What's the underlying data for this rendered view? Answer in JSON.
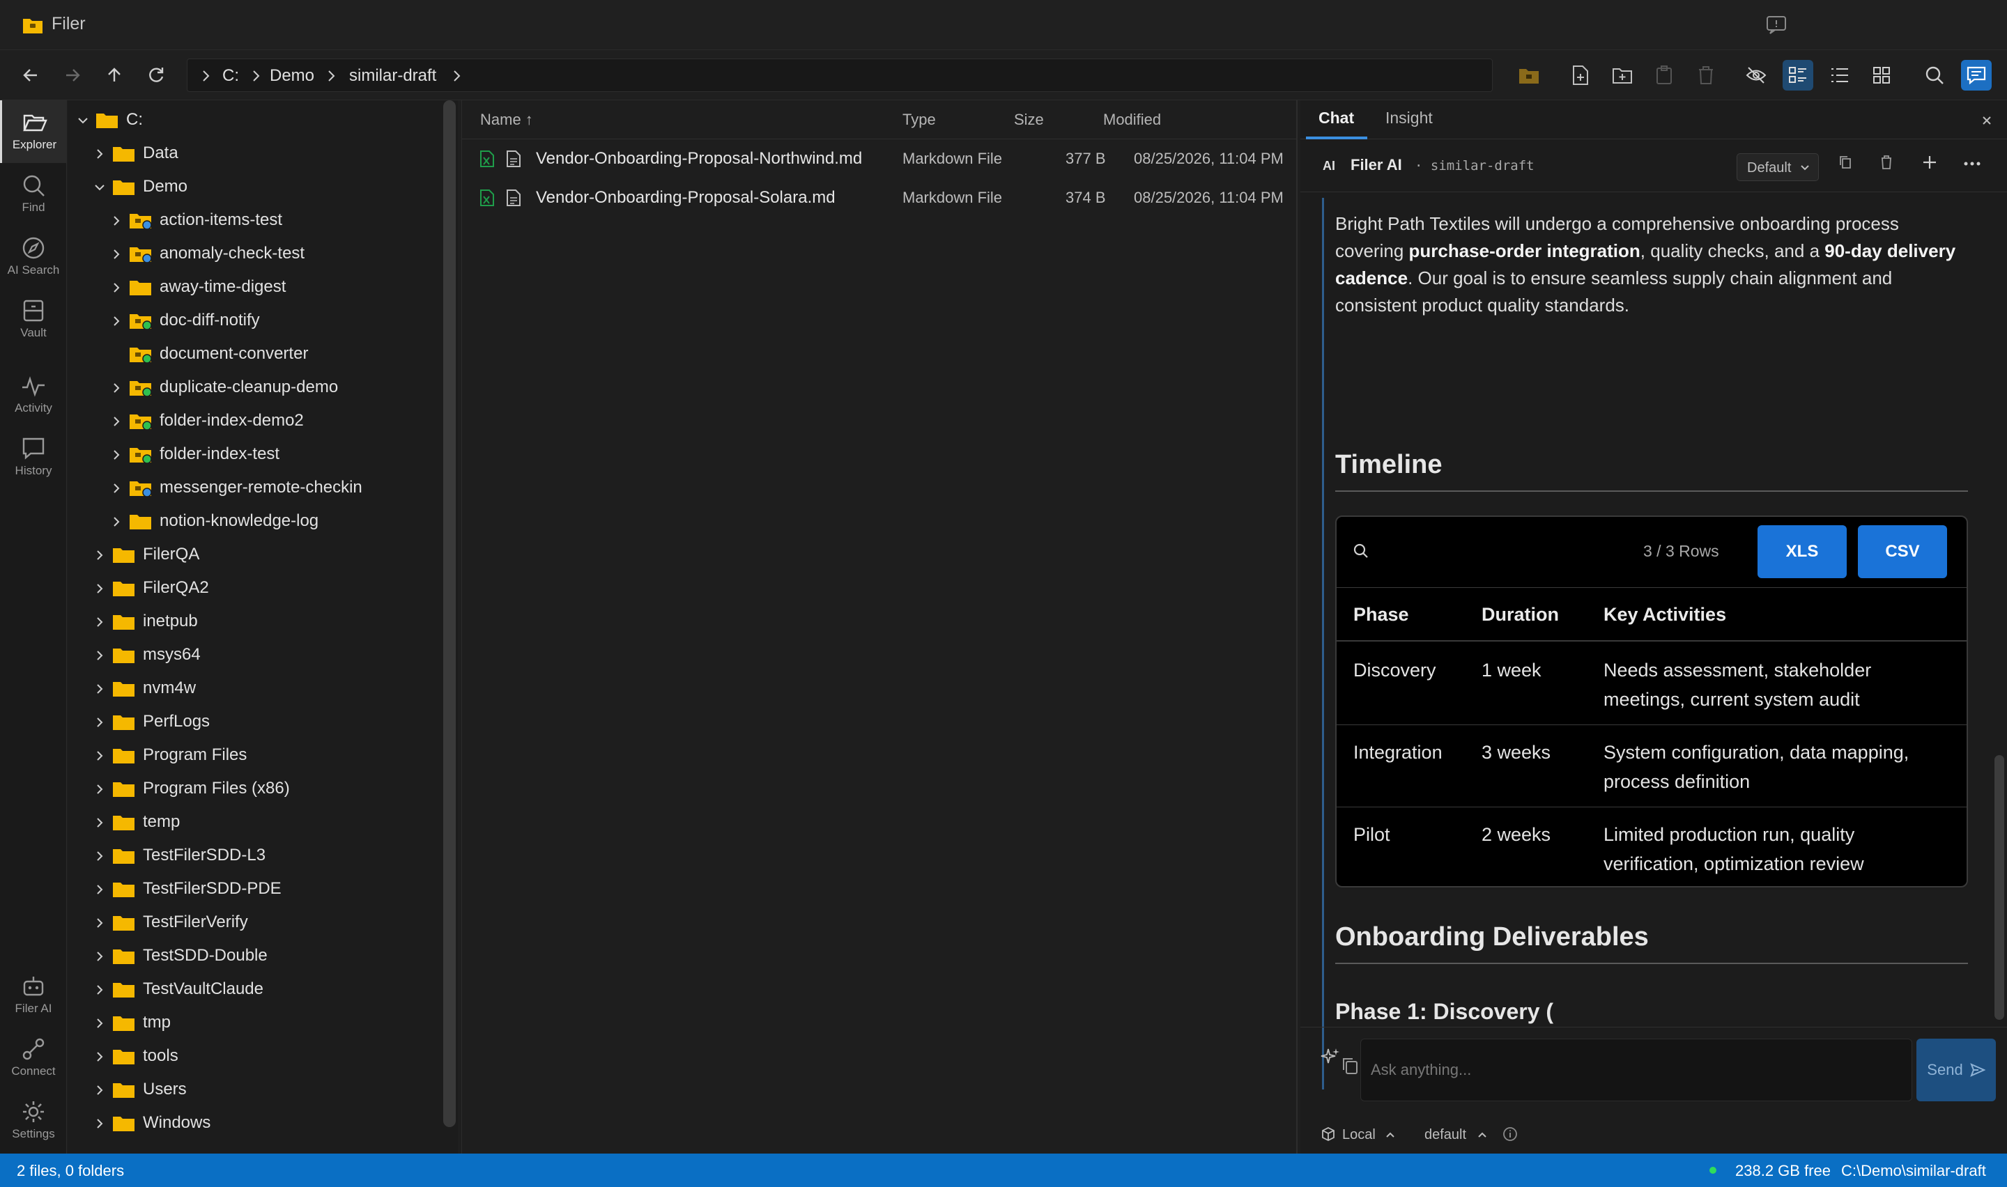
{
  "app": {
    "title": "Filer"
  },
  "toolbar": {
    "breadcrumb": [
      "C:",
      "Demo",
      "similar-draft"
    ]
  },
  "activity_bar": [
    {
      "label": "Explorer",
      "icon": "folder-open-icon",
      "active": true
    },
    {
      "label": "Find",
      "icon": "search-icon"
    },
    {
      "label": "AI Search",
      "icon": "compass-icon"
    },
    {
      "label": "Vault",
      "icon": "vault-icon"
    },
    {
      "label": "Activity",
      "icon": "pulse-icon"
    },
    {
      "label": "History",
      "icon": "history-icon"
    },
    {
      "label": "Filer AI",
      "icon": "robot-icon"
    },
    {
      "label": "Connect",
      "icon": "connect-icon"
    },
    {
      "label": "Settings",
      "icon": "gear-icon"
    }
  ],
  "tree": [
    {
      "label": "C:",
      "level": 0,
      "expanded": true
    },
    {
      "label": "Data",
      "level": 1
    },
    {
      "label": "Demo",
      "level": 1,
      "expanded": true
    },
    {
      "label": "action-items-test",
      "level": 2,
      "badge": "blue"
    },
    {
      "label": "anomaly-check-test",
      "level": 2,
      "badge": "blue"
    },
    {
      "label": "away-time-digest",
      "level": 2
    },
    {
      "label": "doc-diff-notify",
      "level": 2,
      "badge": "green"
    },
    {
      "label": "document-converter",
      "level": 2,
      "badge": "green",
      "no_chevron": true
    },
    {
      "label": "duplicate-cleanup-demo",
      "level": 2,
      "badge": "green"
    },
    {
      "label": "folder-index-demo2",
      "level": 2,
      "badge": "green"
    },
    {
      "label": "folder-index-test",
      "level": 2,
      "badge": "green"
    },
    {
      "label": "messenger-remote-checkin",
      "level": 2,
      "badge": "blue"
    },
    {
      "label": "notion-knowledge-log",
      "level": 2
    },
    {
      "label": "FilerQA",
      "level": 1
    },
    {
      "label": "FilerQA2",
      "level": 1
    },
    {
      "label": "inetpub",
      "level": 1
    },
    {
      "label": "msys64",
      "level": 1
    },
    {
      "label": "nvm4w",
      "level": 1
    },
    {
      "label": "PerfLogs",
      "level": 1
    },
    {
      "label": "Program Files",
      "level": 1
    },
    {
      "label": "Program Files (x86)",
      "level": 1
    },
    {
      "label": "temp",
      "level": 1
    },
    {
      "label": "TestFilerSDD-L3",
      "level": 1
    },
    {
      "label": "TestFilerSDD-PDE",
      "level": 1
    },
    {
      "label": "TestFilerVerify",
      "level": 1
    },
    {
      "label": "TestSDD-Double",
      "level": 1
    },
    {
      "label": "TestVaultClaude",
      "level": 1
    },
    {
      "label": "tmp",
      "level": 1
    },
    {
      "label": "tools",
      "level": 1
    },
    {
      "label": "Users",
      "level": 1
    },
    {
      "label": "Windows",
      "level": 1
    }
  ],
  "file_list": {
    "columns": {
      "name": "Name ↑",
      "type": "Type",
      "size": "Size",
      "modified": "Modified"
    },
    "files": [
      {
        "name": "Vendor-Onboarding-Proposal-Northwind.md",
        "type": "Markdown File",
        "size": "377 B",
        "modified": "08/25/2026, 11:04 PM"
      },
      {
        "name": "Vendor-Onboarding-Proposal-Solara.md",
        "type": "Markdown File",
        "size": "374 B",
        "modified": "08/25/2026, 11:04 PM"
      }
    ]
  },
  "chat": {
    "tabs": [
      "Chat",
      "Insight"
    ],
    "header": {
      "badge": "AI",
      "name": "Filer AI",
      "context": "· similar-draft",
      "mode": "Default"
    },
    "message": {
      "intro_parts": [
        {
          "text": "Bright Path Textiles will undergo a comprehensive onboarding process covering ",
          "bold": false
        },
        {
          "text": "purchase-order integration",
          "bold": true
        },
        {
          "text": ", quality checks, and a ",
          "bold": false
        },
        {
          "text": "90-day delivery cadence",
          "bold": true
        },
        {
          "text": ". Our goal is to ensure seamless supply chain alignment and consistent product quality standards.",
          "bold": false
        }
      ],
      "timeline_heading": "Timeline",
      "table": {
        "rows_count": "3 / 3 Rows",
        "export_xls": "XLS",
        "export_csv": "CSV",
        "headers": [
          "Phase",
          "Duration",
          "Key Activities"
        ],
        "rows": [
          [
            "Discovery",
            "1 week",
            "Needs assessment, stakeholder meetings, current system audit"
          ],
          [
            "Integration",
            "3 weeks",
            "System configuration, data mapping, process definition"
          ],
          [
            "Pilot",
            "2 weeks",
            "Limited production run, quality verification, optimization review"
          ]
        ]
      },
      "deliverables_heading": "Onboarding Deliverables",
      "phase1_heading": "Phase 1: Discovery ("
    },
    "input": {
      "placeholder": "Ask anything...",
      "send_label": "Send"
    },
    "footer": {
      "location": "Local",
      "profile": "default"
    }
  },
  "statusbar": {
    "left": "2 files, 0 folders",
    "free": "238.2 GB free",
    "path": "C:\\Demo\\similar-draft"
  },
  "colors": {
    "accent": "#0a6fc4",
    "folder": "#f5b800",
    "badge_blue": "#3b8fe0",
    "badge_green": "#2fbf4f",
    "excel_green": "#1f9d4a"
  }
}
